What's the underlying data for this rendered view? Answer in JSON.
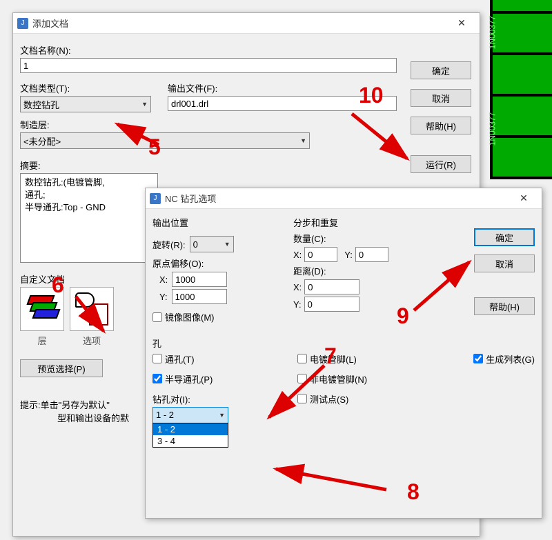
{
  "pcb_label": "1N00377",
  "dialog1": {
    "title": "添加文档",
    "labels": {
      "doc_name": "文档名称(N):",
      "doc_type": "文档类型(T):",
      "output_file": "输出文件(F):",
      "fab_layer": "制造层:",
      "summary": "摘要:",
      "custom_doc": "自定义文档"
    },
    "doc_name_value": "1",
    "doc_type_value": "数控钻孔",
    "output_file_value": "drl001.drl",
    "fab_layer_value": "<未分配>",
    "summary_lines": {
      "l1": "数控钻孔:(电镀管脚,",
      "l2": "通孔;",
      "l3": "半导通孔:Top - GND"
    },
    "icon_labels": {
      "layers": "层",
      "options": "选项"
    },
    "buttons": {
      "ok": "确定",
      "cancel": "取消",
      "help": "帮助(H)",
      "run": "运行(R)",
      "preview": "预览选择(P)"
    },
    "hint": "提示:单击\"另存为默认\"\n               型和输出设备的默"
  },
  "dialog2": {
    "title": "NC 钻孔选项",
    "groups": {
      "output_pos": "输出位置",
      "step_repeat": "分步和重复",
      "hole": "孔"
    },
    "labels": {
      "rotate": "旋转(R):",
      "origin_offset": "原点偏移(O):",
      "x": "X:",
      "y": "Y:",
      "mirror": "镜像图像(M)",
      "count": "数量(C):",
      "distance": "距离(D):",
      "through": "通孔(T)",
      "partial_through": "半导通孔(P)",
      "drill_pair": "钻孔对(I):",
      "plated": "电镀管脚(L)",
      "nonplated": "非电镀管脚(N)",
      "test_point": "测试点(S)",
      "gen_list": "生成列表(G)"
    },
    "values": {
      "rotate": "0",
      "origin_x": "1000",
      "origin_y": "1000",
      "count_x": "0",
      "count_y": "0",
      "dist_x": "0",
      "dist_y": "0",
      "drill_pair_selected": "1 - 2",
      "drill_pair_options": {
        "o1": "1 - 2",
        "o2": "3 - 4"
      }
    },
    "checks": {
      "mirror": false,
      "through": false,
      "partial_through": true,
      "plated": false,
      "nonplated": false,
      "test_point": false,
      "gen_list": true
    },
    "buttons": {
      "ok": "确定",
      "cancel": "取消",
      "help": "帮助(H)"
    }
  },
  "annotations": {
    "n5": "5",
    "n6": "6",
    "n7": "7",
    "n8": "8",
    "n9": "9",
    "n10": "10"
  }
}
